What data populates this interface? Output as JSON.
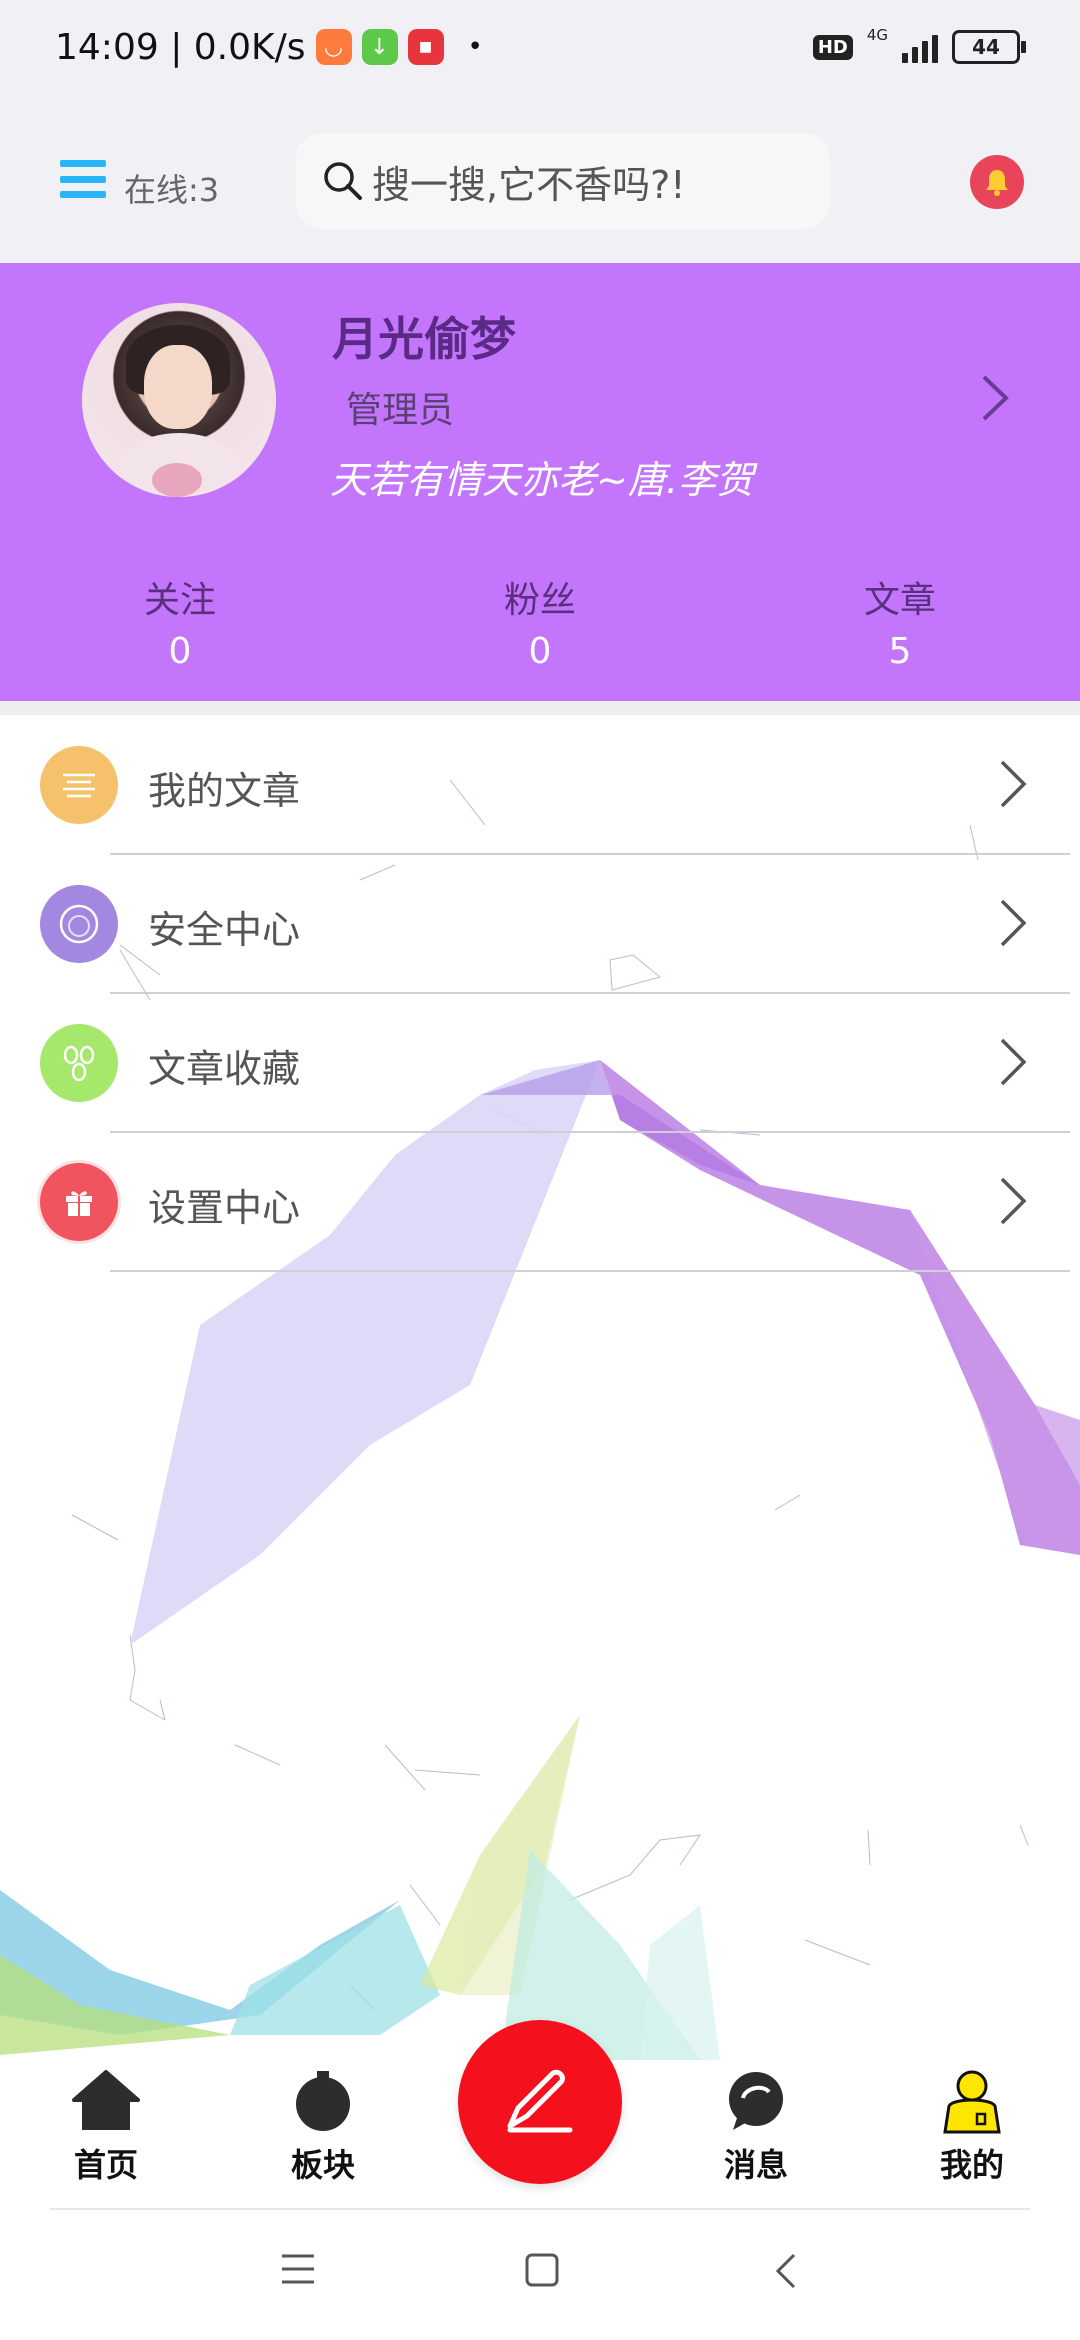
{
  "status_bar": {
    "time_speed": "14:09 | 0.0K/s",
    "hd": "HD",
    "network": "4G",
    "battery": "44",
    "dot": "•"
  },
  "header": {
    "online": "在线:3",
    "search_placeholder": "搜一搜,它不香吗?!"
  },
  "profile": {
    "name": "月光偷梦",
    "role": "管理员",
    "motto": "天若有情天亦老~唐.李贺",
    "stats": [
      {
        "label": "关注",
        "value": "0"
      },
      {
        "label": "粉丝",
        "value": "0"
      },
      {
        "label": "文章",
        "value": "5"
      }
    ]
  },
  "menu": [
    {
      "label": "我的文章",
      "icon": "article-icon",
      "color": "#f5c26b"
    },
    {
      "label": "安全中心",
      "icon": "security-icon",
      "color": "#a487e0"
    },
    {
      "label": "文章收藏",
      "icon": "favorites-icon",
      "color": "#a6e86b"
    },
    {
      "label": "设置中心",
      "icon": "gift-icon",
      "color": "#f0545e"
    }
  ],
  "bottom_nav": [
    {
      "label": "首页",
      "icon": "home-icon"
    },
    {
      "label": "板块",
      "icon": "board-icon"
    },
    {
      "label": "消息",
      "icon": "message-icon"
    },
    {
      "label": "我的",
      "icon": "profile-icon"
    }
  ],
  "colors": {
    "header_bg": "#f1f0f5",
    "profile_bg": "#c376fc",
    "fab": "#f5101e",
    "menu_icon": "#29b6f6",
    "bell": "#e8445a"
  }
}
